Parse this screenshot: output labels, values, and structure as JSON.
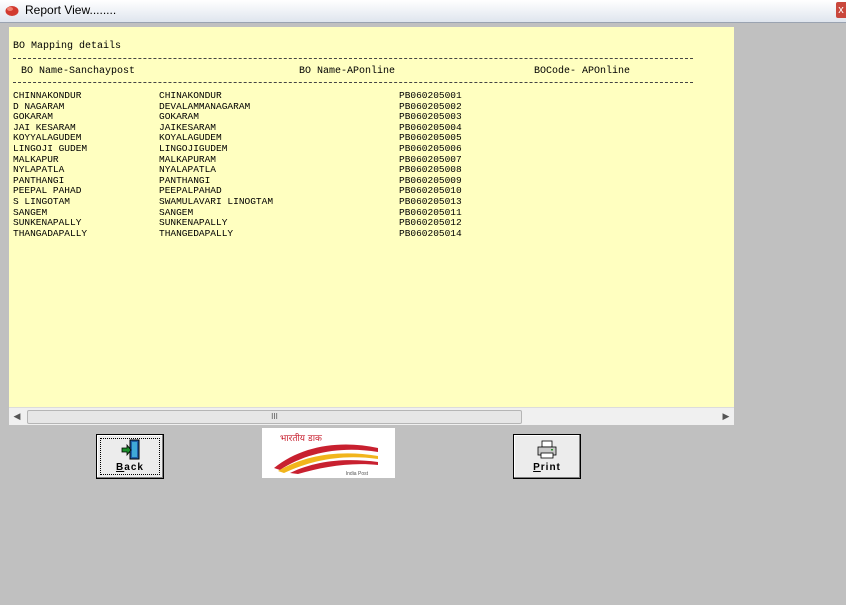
{
  "window": {
    "title": "Report View........",
    "close_label": "x"
  },
  "report": {
    "title": "BO Mapping details",
    "columns": [
      "BO Name-Sanchaypost",
      "BO Name-APonline",
      "BOCode- APOnline"
    ],
    "rows": [
      [
        "CHINNAKONDUR",
        "CHINAKONDUR",
        "PB060205001"
      ],
      [
        "D NAGARAM",
        "DEVALAMMANAGARAM",
        "PB060205002"
      ],
      [
        "GOKARAM",
        "GOKARAM",
        "PB060205003"
      ],
      [
        "JAI KESARAM",
        "JAIKESARAM",
        "PB060205004"
      ],
      [
        "KOYYALAGUDEM",
        "KOYALAGUDEM",
        "PB060205005"
      ],
      [
        "LINGOJI GUDEM",
        "LINGOJIGUDEM",
        "PB060205006"
      ],
      [
        "MALKAPUR",
        "MALKAPURAM",
        "PB060205007"
      ],
      [
        "NYLAPATLA",
        "NYALAPATLA",
        "PB060205008"
      ],
      [
        "PANTHANGI",
        "PANTHANGI",
        "PB060205009"
      ],
      [
        "PEEPAL PAHAD",
        "PEEPALPAHAD",
        "PB060205010"
      ],
      [
        "S LINGOTAM",
        "SWAMULAVARI LINOGTAM",
        "PB060205013"
      ],
      [
        "SANGEM",
        "SANGEM",
        "PB060205011"
      ],
      [
        "SUNKENAPALLY",
        "SUNKENAPALLY",
        "PB060205012"
      ],
      [
        "THANGADAPALLY",
        "THANGEDAPALLY",
        "PB060205014"
      ]
    ]
  },
  "scrollbar": {
    "left_arrow": "◀",
    "right_arrow": "▶",
    "thumb_grip": "III"
  },
  "buttons": {
    "back": {
      "accel": "B",
      "rest": "ack",
      "icon": "exit-door-icon"
    },
    "print": {
      "accel": "P",
      "rest": "rint",
      "icon": "printer-icon"
    }
  },
  "logo": {
    "text": "भारतीय डाक",
    "subtext": "India Post"
  }
}
